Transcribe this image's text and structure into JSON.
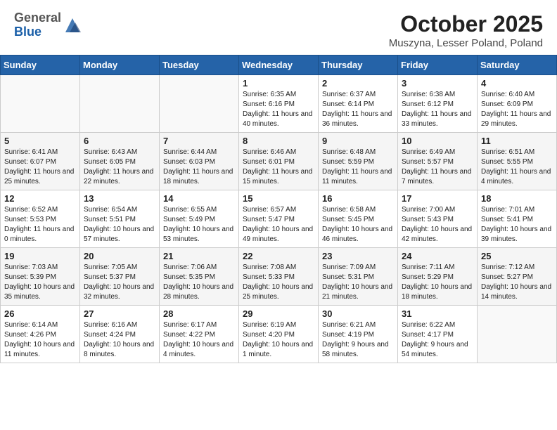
{
  "header": {
    "logo_general": "General",
    "logo_blue": "Blue",
    "month": "October 2025",
    "location": "Muszyna, Lesser Poland, Poland"
  },
  "days_of_week": [
    "Sunday",
    "Monday",
    "Tuesday",
    "Wednesday",
    "Thursday",
    "Friday",
    "Saturday"
  ],
  "weeks": [
    [
      {
        "day": "",
        "info": ""
      },
      {
        "day": "",
        "info": ""
      },
      {
        "day": "",
        "info": ""
      },
      {
        "day": "1",
        "info": "Sunrise: 6:35 AM\nSunset: 6:16 PM\nDaylight: 11 hours and 40 minutes."
      },
      {
        "day": "2",
        "info": "Sunrise: 6:37 AM\nSunset: 6:14 PM\nDaylight: 11 hours and 36 minutes."
      },
      {
        "day": "3",
        "info": "Sunrise: 6:38 AM\nSunset: 6:12 PM\nDaylight: 11 hours and 33 minutes."
      },
      {
        "day": "4",
        "info": "Sunrise: 6:40 AM\nSunset: 6:09 PM\nDaylight: 11 hours and 29 minutes."
      }
    ],
    [
      {
        "day": "5",
        "info": "Sunrise: 6:41 AM\nSunset: 6:07 PM\nDaylight: 11 hours and 25 minutes."
      },
      {
        "day": "6",
        "info": "Sunrise: 6:43 AM\nSunset: 6:05 PM\nDaylight: 11 hours and 22 minutes."
      },
      {
        "day": "7",
        "info": "Sunrise: 6:44 AM\nSunset: 6:03 PM\nDaylight: 11 hours and 18 minutes."
      },
      {
        "day": "8",
        "info": "Sunrise: 6:46 AM\nSunset: 6:01 PM\nDaylight: 11 hours and 15 minutes."
      },
      {
        "day": "9",
        "info": "Sunrise: 6:48 AM\nSunset: 5:59 PM\nDaylight: 11 hours and 11 minutes."
      },
      {
        "day": "10",
        "info": "Sunrise: 6:49 AM\nSunset: 5:57 PM\nDaylight: 11 hours and 7 minutes."
      },
      {
        "day": "11",
        "info": "Sunrise: 6:51 AM\nSunset: 5:55 PM\nDaylight: 11 hours and 4 minutes."
      }
    ],
    [
      {
        "day": "12",
        "info": "Sunrise: 6:52 AM\nSunset: 5:53 PM\nDaylight: 11 hours and 0 minutes."
      },
      {
        "day": "13",
        "info": "Sunrise: 6:54 AM\nSunset: 5:51 PM\nDaylight: 10 hours and 57 minutes."
      },
      {
        "day": "14",
        "info": "Sunrise: 6:55 AM\nSunset: 5:49 PM\nDaylight: 10 hours and 53 minutes."
      },
      {
        "day": "15",
        "info": "Sunrise: 6:57 AM\nSunset: 5:47 PM\nDaylight: 10 hours and 49 minutes."
      },
      {
        "day": "16",
        "info": "Sunrise: 6:58 AM\nSunset: 5:45 PM\nDaylight: 10 hours and 46 minutes."
      },
      {
        "day": "17",
        "info": "Sunrise: 7:00 AM\nSunset: 5:43 PM\nDaylight: 10 hours and 42 minutes."
      },
      {
        "day": "18",
        "info": "Sunrise: 7:01 AM\nSunset: 5:41 PM\nDaylight: 10 hours and 39 minutes."
      }
    ],
    [
      {
        "day": "19",
        "info": "Sunrise: 7:03 AM\nSunset: 5:39 PM\nDaylight: 10 hours and 35 minutes."
      },
      {
        "day": "20",
        "info": "Sunrise: 7:05 AM\nSunset: 5:37 PM\nDaylight: 10 hours and 32 minutes."
      },
      {
        "day": "21",
        "info": "Sunrise: 7:06 AM\nSunset: 5:35 PM\nDaylight: 10 hours and 28 minutes."
      },
      {
        "day": "22",
        "info": "Sunrise: 7:08 AM\nSunset: 5:33 PM\nDaylight: 10 hours and 25 minutes."
      },
      {
        "day": "23",
        "info": "Sunrise: 7:09 AM\nSunset: 5:31 PM\nDaylight: 10 hours and 21 minutes."
      },
      {
        "day": "24",
        "info": "Sunrise: 7:11 AM\nSunset: 5:29 PM\nDaylight: 10 hours and 18 minutes."
      },
      {
        "day": "25",
        "info": "Sunrise: 7:12 AM\nSunset: 5:27 PM\nDaylight: 10 hours and 14 minutes."
      }
    ],
    [
      {
        "day": "26",
        "info": "Sunrise: 6:14 AM\nSunset: 4:26 PM\nDaylight: 10 hours and 11 minutes."
      },
      {
        "day": "27",
        "info": "Sunrise: 6:16 AM\nSunset: 4:24 PM\nDaylight: 10 hours and 8 minutes."
      },
      {
        "day": "28",
        "info": "Sunrise: 6:17 AM\nSunset: 4:22 PM\nDaylight: 10 hours and 4 minutes."
      },
      {
        "day": "29",
        "info": "Sunrise: 6:19 AM\nSunset: 4:20 PM\nDaylight: 10 hours and 1 minute."
      },
      {
        "day": "30",
        "info": "Sunrise: 6:21 AM\nSunset: 4:19 PM\nDaylight: 9 hours and 58 minutes."
      },
      {
        "day": "31",
        "info": "Sunrise: 6:22 AM\nSunset: 4:17 PM\nDaylight: 9 hours and 54 minutes."
      },
      {
        "day": "",
        "info": ""
      }
    ]
  ]
}
